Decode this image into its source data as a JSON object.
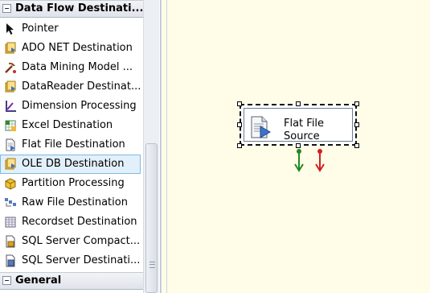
{
  "toolbox": {
    "groups": {
      "data_flow_destinations": "Data Flow Destinati...",
      "general": "General"
    },
    "items": [
      {
        "label": "Pointer",
        "icon": "pointer-icon"
      },
      {
        "label": "ADO NET Destination",
        "icon": "ado-net-destination-icon"
      },
      {
        "label": "Data Mining Model ...",
        "icon": "data-mining-model-icon"
      },
      {
        "label": "DataReader Destinat...",
        "icon": "datareader-destination-icon"
      },
      {
        "label": "Dimension Processing",
        "icon": "dimension-processing-icon"
      },
      {
        "label": "Excel Destination",
        "icon": "excel-destination-icon"
      },
      {
        "label": "Flat File Destination",
        "icon": "flat-file-destination-icon"
      },
      {
        "label": "OLE DB Destination",
        "icon": "ole-db-destination-icon",
        "selected": true
      },
      {
        "label": "Partition Processing",
        "icon": "partition-processing-icon"
      },
      {
        "label": "Raw File Destination",
        "icon": "raw-file-destination-icon"
      },
      {
        "label": "Recordset Destination",
        "icon": "recordset-destination-icon"
      },
      {
        "label": "SQL Server Compact...",
        "icon": "sql-server-compact-icon"
      },
      {
        "label": "SQL Server Destinati...",
        "icon": "sql-server-destination-icon"
      }
    ]
  },
  "designer": {
    "component": {
      "label": "Flat File Source",
      "icon": "flat-file-source-icon"
    },
    "outputs": [
      {
        "name": "success-output",
        "color": "#1f8a1f"
      },
      {
        "name": "error-output",
        "color": "#d42020"
      }
    ]
  },
  "colors": {
    "selection_bg": "#e2f0fb",
    "selection_border": "#7fb8e2",
    "designer_bg": "#fffde7"
  }
}
